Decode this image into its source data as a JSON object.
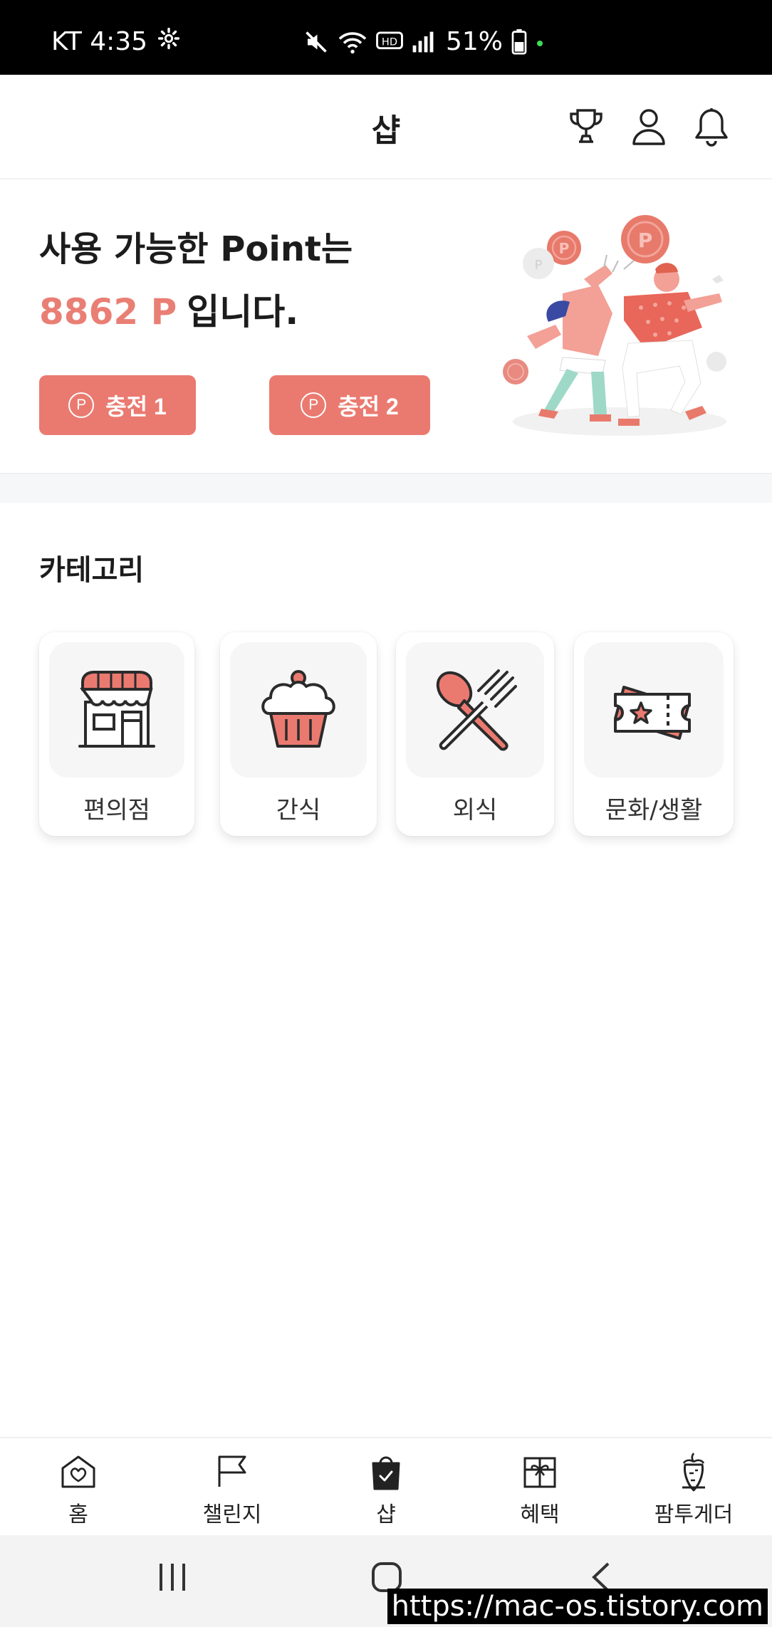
{
  "status_bar": {
    "carrier_time": "KT 4:35",
    "battery": "51%"
  },
  "header": {
    "title": "샵"
  },
  "points": {
    "line1": "사용 가능한 Point는",
    "value": "8862 P",
    "suffix": "입니다.",
    "charge_buttons": [
      {
        "icon_text": "P",
        "label": "충전 1"
      },
      {
        "icon_text": "P",
        "label": "충전 2"
      }
    ]
  },
  "categories": {
    "title": "카테고리",
    "items": [
      {
        "label": "편의점",
        "icon": "store-icon"
      },
      {
        "label": "간식",
        "icon": "cupcake-icon"
      },
      {
        "label": "외식",
        "icon": "fork-spoon-icon"
      },
      {
        "label": "문화/생활",
        "icon": "ticket-icon"
      }
    ]
  },
  "bottom_nav": {
    "items": [
      {
        "label": "홈",
        "icon": "home-heart-icon"
      },
      {
        "label": "챌린지",
        "icon": "flag-icon"
      },
      {
        "label": "샵",
        "icon": "shopping-bag-icon",
        "active": true
      },
      {
        "label": "혜택",
        "icon": "gift-icon"
      },
      {
        "label": "팜투게더",
        "icon": "carrot-icon"
      }
    ]
  },
  "watermark": "https://mac-os.tistory.com",
  "colors": {
    "accent": "#ea7a70",
    "point_text": "#e97f74"
  }
}
